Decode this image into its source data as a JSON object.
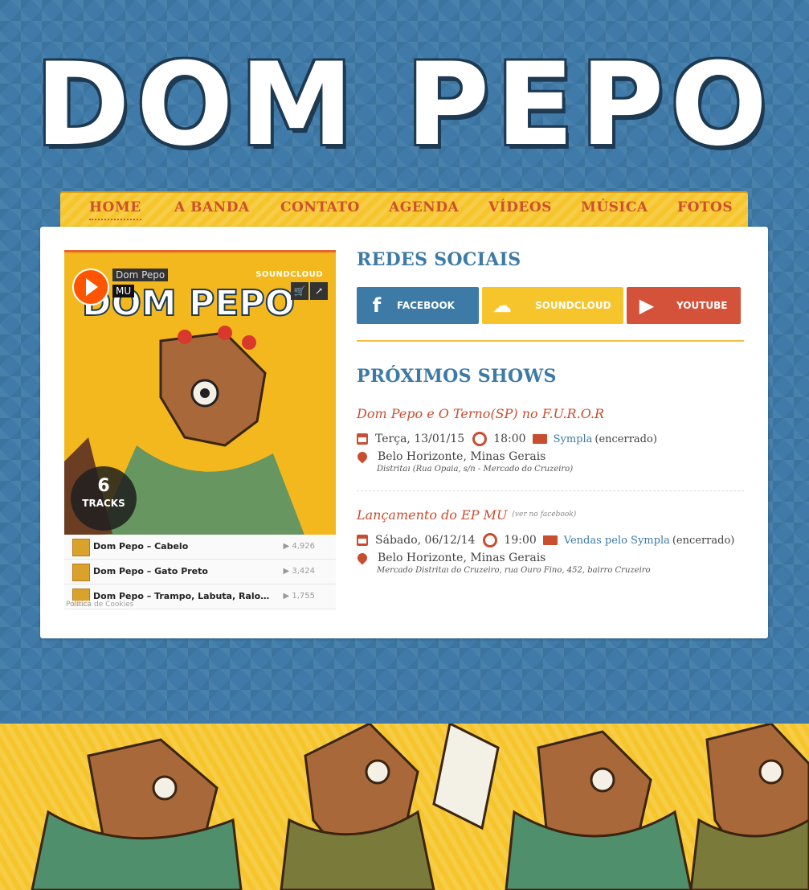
{
  "site": {
    "title": "DOM PEPO"
  },
  "nav": {
    "items": [
      {
        "label": "HOME",
        "active": true
      },
      {
        "label": "A BANDA"
      },
      {
        "label": "CONTATO"
      },
      {
        "label": "AGENDA"
      },
      {
        "label": "VÍDEOS"
      },
      {
        "label": "MÚSICA"
      },
      {
        "label": "FOTOS"
      }
    ]
  },
  "player": {
    "artist": "Dom Pepo",
    "album": "MU",
    "brand": "SOUNDCLOUD",
    "track_count": "6",
    "tracks_label": "TRACKS",
    "cookies": "Política de Cookies",
    "tracks": [
      {
        "title": "Dom Pepo – Cabelo",
        "plays": "4,926"
      },
      {
        "title": "Dom Pepo – Gato Preto",
        "plays": "3,424"
      },
      {
        "title": "Dom Pepo – Trampo, Labuta, Ralo (Vi...",
        "plays": "1,755"
      }
    ]
  },
  "social": {
    "title": "REDES SOCIAIS",
    "facebook": "FACEBOOK",
    "soundcloud": "SOUNDCLOUD",
    "youtube": "YOUTUBE"
  },
  "shows": {
    "title": "PRÓXIMOS SHOWS",
    "list": [
      {
        "name": "Dom Pepo e O Terno(SP) no F.U.R.O.R",
        "note": "",
        "date": "Terça, 13/01/15",
        "time": "18:00",
        "ticket_link": "Sympla",
        "ticket_status": "(encerrado)",
        "city": "Belo Horizonte, Minas Gerais",
        "address": "Distritaı (Rua Opaia, s/n - Mercado do Cruzeiro)"
      },
      {
        "name": "Lançamento do EP MU",
        "note": "(ver no facebook)",
        "date": "Sábado, 06/12/14",
        "time": "19:00",
        "ticket_link": "Vendas pelo Sympla",
        "ticket_status": "(encerrado)",
        "city": "Belo Horizonte, Minas Gerais",
        "address": "Mercado Distritaı do Cruzeiro, rua Ouro Fino, 452, bairro Cruzeiro"
      }
    ]
  },
  "colors": {
    "background": "#3f7aa9",
    "nav": "#f6c52c",
    "accent_red": "#c94d2f",
    "accent_blue": "#3d7aa6"
  }
}
